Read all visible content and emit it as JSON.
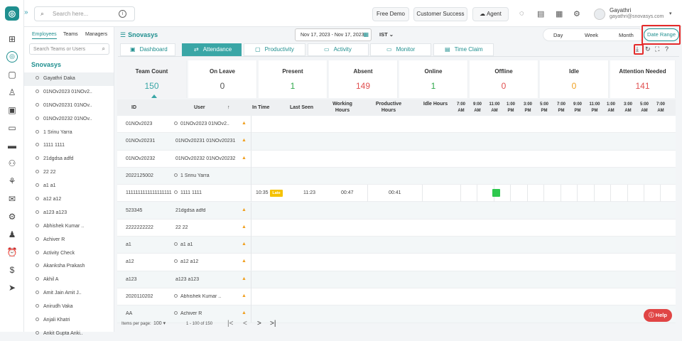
{
  "header": {
    "search_placeholder": "Search here...",
    "free_demo": "Free Demo",
    "customer_success": "Customer Success",
    "agent": "Agent",
    "user_name": "Gayathri",
    "user_email": "gayathri@snovasys.com"
  },
  "panel": {
    "tabs": [
      "Employees",
      "Teams",
      "Managers"
    ],
    "search_placeholder": "Search Teams or Users",
    "company": "Snovasys",
    "employees": [
      "Gayathri Daka",
      "01NOv2023 01NOv2..",
      "01NOv20231 01NOv..",
      "01NOv20232 01NOv..",
      "1 Srinu Yarra",
      "1111 1111",
      "21dgdsa adfd",
      "22 22",
      "a1 a1",
      "a12 a12",
      "a123 a123",
      "Abhishek Kumar ..",
      "Achiver R",
      "Activity Check",
      "Akanksha Prakash",
      "Akhil A",
      "Amit Jain Amit J..",
      "Anirudh Vaka",
      "Anjali Khatri",
      "Ankit Gupta Anki.."
    ]
  },
  "main": {
    "company": "Snovasys",
    "date_range": "Nov 17, 2023 - Nov 17, 2023",
    "timezone": "IST",
    "period": {
      "day": "Day",
      "week": "Week",
      "month": "Month",
      "date_range": "Date Range"
    },
    "tabs": [
      "Dashboard",
      "Attendance",
      "Productivity",
      "Activity",
      "Monitor",
      "Time Claim"
    ],
    "cards": [
      {
        "title": "Team Count",
        "value": "150",
        "color": "#3aa6a6"
      },
      {
        "title": "On Leave",
        "value": "0",
        "color": "#555555"
      },
      {
        "title": "Present",
        "value": "1",
        "color": "#2ea84a"
      },
      {
        "title": "Absent",
        "value": "149",
        "color": "#e05050"
      },
      {
        "title": "Online",
        "value": "1",
        "color": "#2ea84a"
      },
      {
        "title": "Offline",
        "value": "0",
        "color": "#e05050"
      },
      {
        "title": "Idle",
        "value": "0",
        "color": "#f0a020"
      },
      {
        "title": "Attention Needed",
        "value": "141",
        "color": "#e05050"
      }
    ],
    "columns": {
      "id": "ID",
      "user": "User",
      "sort": "↑",
      "in_time": "In Time",
      "last_seen": "Last Seen",
      "working": "Working Hours",
      "productive": "Productive Hours",
      "idle": "Idle Hours",
      "hours": [
        "7:00 AM",
        "9:00 AM",
        "11:00 AM",
        "1:00 PM",
        "3:00 PM",
        "5:00 PM",
        "7:00 PM",
        "9:00 PM",
        "11:00 PM",
        "1:00 AM",
        "3:00 AM",
        "5:00 AM",
        "7:00 AM"
      ]
    },
    "rows": [
      {
        "id": "01NOv2023",
        "user": "01NOv2023 01NOv2..",
        "dot": true,
        "warn": true
      },
      {
        "id": "01NOv20231",
        "user": "01NOv20231 01NOv20231",
        "dot": false,
        "warn": true
      },
      {
        "id": "01NOv20232",
        "user": "01NOv20232 01NOv20232",
        "dot": false,
        "warn": true
      },
      {
        "id": "2022125002",
        "user": "1 Srinu Yarra",
        "dot": true,
        "warn": false
      },
      {
        "id": "1111111111111111111",
        "user": "1111 1111",
        "dot": true,
        "warn": false,
        "in_time": "10:35",
        "late": "Late",
        "last_seen": "11:23",
        "working": "00:47",
        "productive": "00:41",
        "active": true
      },
      {
        "id": "523345",
        "user": "21dgdsa adfd",
        "dot": false,
        "warn": true
      },
      {
        "id": "2222222222",
        "user": "22 22",
        "dot": false,
        "warn": true
      },
      {
        "id": "a1",
        "user": "a1 a1",
        "dot": true,
        "warn": true
      },
      {
        "id": "a12",
        "user": "a12 a12",
        "dot": true,
        "warn": true
      },
      {
        "id": "a123",
        "user": "a123 a123",
        "dot": false,
        "warn": true
      },
      {
        "id": "2020110202",
        "user": "Abhishek Kumar ..",
        "dot": true,
        "warn": true
      },
      {
        "id": "AA",
        "user": "Achiver R",
        "dot": true,
        "warn": true
      }
    ]
  },
  "footer": {
    "items_label": "Items per page:",
    "page_size": "100",
    "range": "1 - 100 of 150"
  },
  "help": "Help"
}
